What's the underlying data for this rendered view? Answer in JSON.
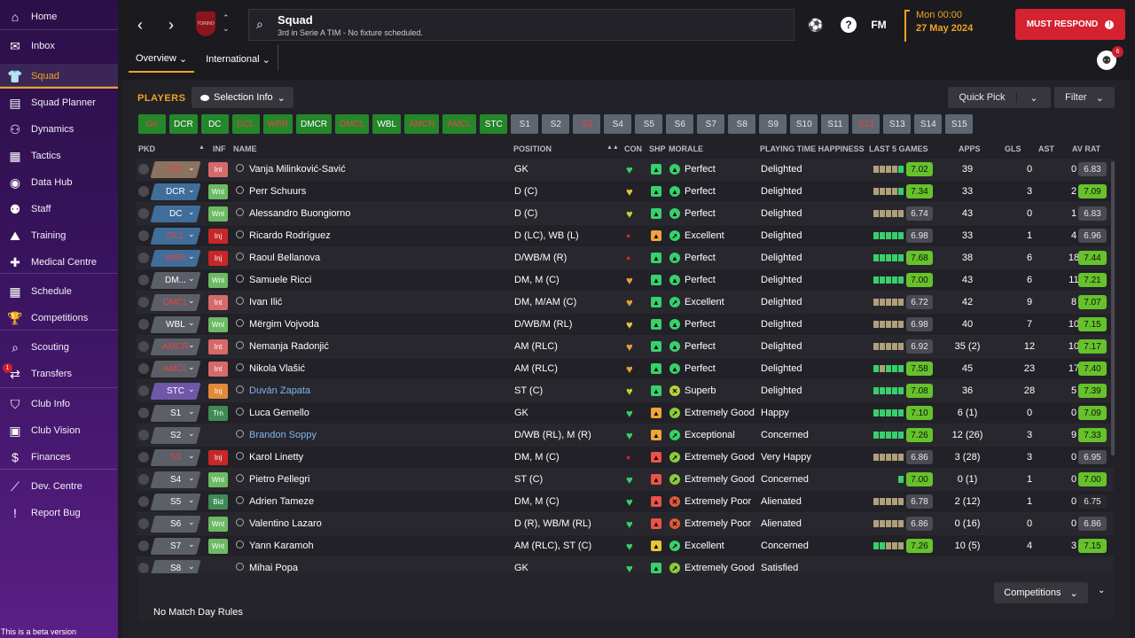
{
  "sidebar": {
    "items": [
      {
        "label": "Home",
        "icon": "home-icon",
        "glyph": "⌂"
      },
      {
        "label": "Inbox",
        "icon": "inbox-icon",
        "glyph": "✉"
      },
      {
        "label": "Squad",
        "icon": "shirt-icon",
        "glyph": "👕"
      },
      {
        "label": "Squad Planner",
        "icon": "clipboard-icon",
        "glyph": "▤"
      },
      {
        "label": "Dynamics",
        "icon": "dynamics-icon",
        "glyph": "⚇"
      },
      {
        "label": "Tactics",
        "icon": "tactics-icon",
        "glyph": "▦"
      },
      {
        "label": "Data Hub",
        "icon": "data-hub-icon",
        "glyph": "◉"
      },
      {
        "label": "Staff",
        "icon": "staff-icon",
        "glyph": "⚉"
      },
      {
        "label": "Training",
        "icon": "training-icon",
        "glyph": "⛰"
      },
      {
        "label": "Medical Centre",
        "icon": "medical-icon",
        "glyph": "✚"
      },
      {
        "label": "Schedule",
        "icon": "calendar-icon",
        "glyph": "▦"
      },
      {
        "label": "Competitions",
        "icon": "trophy-icon",
        "glyph": "🏆"
      },
      {
        "label": "Scouting",
        "icon": "search-icon",
        "glyph": "⌕"
      },
      {
        "label": "Transfers",
        "icon": "transfers-icon",
        "glyph": "⇄",
        "badge": "1"
      },
      {
        "label": "Club Info",
        "icon": "shield-icon",
        "glyph": "⛉"
      },
      {
        "label": "Club Vision",
        "icon": "briefcase-icon",
        "glyph": "▣"
      },
      {
        "label": "Finances",
        "icon": "money-icon",
        "glyph": "$"
      },
      {
        "label": "Dev. Centre",
        "icon": "dev-centre-icon",
        "glyph": "⟋"
      },
      {
        "label": "Report Bug",
        "icon": "bug-icon",
        "glyph": "!"
      }
    ],
    "beta_note": "This is a beta version"
  },
  "header": {
    "crest_text": "TORINO",
    "title": "Squad",
    "subtitle": "3rd in Serie A TIM - No fixture scheduled.",
    "fm_logo": "FM",
    "time": "Mon 00:00",
    "date": "27 May 2024",
    "must_respond": "MUST RESPOND",
    "manager_badge": "6",
    "tabs": [
      {
        "label": "Overview"
      },
      {
        "label": "International"
      }
    ]
  },
  "panel": {
    "title": "PLAYERS",
    "selection_info": "Selection Info",
    "quick_pick": "Quick Pick",
    "filter": "Filter",
    "competitions": "Competitions",
    "match_rules": "No Match Day Rules",
    "chips": [
      {
        "label": "GK",
        "state": "warn"
      },
      {
        "label": "DCR",
        "state": "ok"
      },
      {
        "label": "DC",
        "state": "ok"
      },
      {
        "label": "DCL",
        "state": "warn"
      },
      {
        "label": "WBR",
        "state": "warn"
      },
      {
        "label": "DMCR",
        "state": "ok"
      },
      {
        "label": "DMCL",
        "state": "warn"
      },
      {
        "label": "WBL",
        "state": "ok"
      },
      {
        "label": "AMCR",
        "state": "warn"
      },
      {
        "label": "AMCL",
        "state": "warn"
      },
      {
        "label": "STC",
        "state": "ok"
      },
      {
        "label": "S1",
        "state": "sub"
      },
      {
        "label": "S2",
        "state": "sub"
      },
      {
        "label": "S3",
        "state": "subred"
      },
      {
        "label": "S4",
        "state": "sub"
      },
      {
        "label": "S5",
        "state": "sub"
      },
      {
        "label": "S6",
        "state": "sub"
      },
      {
        "label": "S7",
        "state": "sub"
      },
      {
        "label": "S8",
        "state": "sub"
      },
      {
        "label": "S9",
        "state": "sub"
      },
      {
        "label": "S10",
        "state": "sub"
      },
      {
        "label": "S11",
        "state": "sub"
      },
      {
        "label": "S12",
        "state": "subred"
      },
      {
        "label": "S13",
        "state": "sub"
      },
      {
        "label": "S14",
        "state": "sub"
      },
      {
        "label": "S15",
        "state": "sub"
      }
    ],
    "columns": {
      "pkd": "PKD",
      "inf": "INF",
      "name": "NAME",
      "position": "POSITION",
      "con": "CON",
      "shp": "SHP",
      "morale": "MORALE",
      "pth": "PLAYING TIME HAPPINESS",
      "last5": "LAST 5 GAMES",
      "apps": "APPS",
      "gls": "GLS",
      "ast": "AST",
      "avrat": "AV RAT"
    },
    "rows": [
      {
        "pos": "GK",
        "pos_red": true,
        "pos_color": "#8b7360",
        "inf": "Int",
        "inf_color": "#d66a6a",
        "name": "Vanja Milinković-Savić",
        "link": false,
        "position": "GK",
        "con": "heart",
        "con_color": "#37d06c",
        "shp": "#37d06c",
        "morale_icon": "up",
        "morale_color": "#37d06c",
        "morale": "Perfect",
        "pth": "Delighted",
        "last5": [
          "#b0a07a",
          "#b0a07a",
          "#b0a07a",
          "#b0a07a",
          "#37d06c"
        ],
        "form": "7.02",
        "form_color": "#66c22b",
        "apps": "39",
        "gls": "0",
        "ast": "0",
        "avrat": "6.83",
        "avrat_color": "#4a4a52"
      },
      {
        "pos": "DCR",
        "pos_red": false,
        "pos_color": "#3f6e9a",
        "inf": "Wnt",
        "inf_color": "#6cba64",
        "name": "Perr Schuurs",
        "link": false,
        "position": "D (C)",
        "con": "heart",
        "con_color": "#e6c43a",
        "shp": "#37d06c",
        "morale_icon": "up",
        "morale_color": "#37d06c",
        "morale": "Perfect",
        "pth": "Delighted",
        "last5": [
          "#b0a07a",
          "#b0a07a",
          "#b0a07a",
          "#b0a07a",
          "#37d06c"
        ],
        "form": "7.34",
        "form_color": "#66c22b",
        "apps": "33",
        "gls": "3",
        "ast": "2",
        "avrat": "7.09",
        "avrat_color": "#66c22b"
      },
      {
        "pos": "DC",
        "pos_red": false,
        "pos_color": "#3f6e9a",
        "inf": "Wnt",
        "inf_color": "#6cba64",
        "name": "Alessandro Buongiorno",
        "link": false,
        "position": "D (C)",
        "con": "heart",
        "con_color": "#b8d43a",
        "shp": "#37d06c",
        "morale_icon": "up",
        "morale_color": "#37d06c",
        "morale": "Perfect",
        "pth": "Delighted",
        "last5": [
          "#b0a07a",
          "#b0a07a",
          "#b0a07a",
          "#b0a07a",
          "#b0a07a"
        ],
        "form": "6.74",
        "form_color": "#4a4a52",
        "apps": "43",
        "gls": "0",
        "ast": "1",
        "avrat": "6.83",
        "avrat_color": "#4a4a52"
      },
      {
        "pos": "DCL",
        "pos_red": true,
        "pos_color": "#3f6e9a",
        "inf": "Inj",
        "inf_color": "#c62828",
        "name": "Ricardo Rodríguez",
        "link": false,
        "position": "D (LC), WB (L)",
        "con": "dot",
        "con_color": "#c62828",
        "shp": "#f0a43a",
        "morale_icon": "right",
        "morale_color": "#37d06c",
        "morale": "Excellent",
        "pth": "Delighted",
        "last5": [
          "#37d06c",
          "#37d06c",
          "#37d06c",
          "#37d06c",
          "#37d06c"
        ],
        "form": "6.98",
        "form_color": "#4a4a52",
        "apps": "33",
        "gls": "1",
        "ast": "4",
        "avrat": "6.96",
        "avrat_color": "#4a4a52"
      },
      {
        "pos": "WBR",
        "pos_red": true,
        "pos_color": "#3f6e9a",
        "inf": "Inj",
        "inf_color": "#c62828",
        "name": "Raoul Bellanova",
        "link": false,
        "position": "D/WB/M (R)",
        "con": "dot",
        "con_color": "#c62828",
        "shp": "#37d06c",
        "morale_icon": "up",
        "morale_color": "#37d06c",
        "morale": "Perfect",
        "pth": "Delighted",
        "last5": [
          "#37d06c",
          "#37d06c",
          "#37d06c",
          "#37d06c",
          "#37d06c"
        ],
        "form": "7.68",
        "form_color": "#66c22b",
        "apps": "38",
        "gls": "6",
        "ast": "18",
        "avrat": "7.44",
        "avrat_color": "#66c22b"
      },
      {
        "pos": "DM...",
        "pos_red": false,
        "pos_color": "#5b5f68",
        "inf": "Wnt",
        "inf_color": "#6cba64",
        "name": "Samuele Ricci",
        "link": false,
        "position": "DM, M (C)",
        "con": "heart",
        "con_color": "#e6a33a",
        "shp": "#37d06c",
        "morale_icon": "up",
        "morale_color": "#37d06c",
        "morale": "Perfect",
        "pth": "Delighted",
        "last5": [
          "#37d06c",
          "#37d06c",
          "#37d06c",
          "#37d06c",
          "#37d06c"
        ],
        "form": "7.00",
        "form_color": "#66c22b",
        "apps": "43",
        "gls": "6",
        "ast": "11",
        "avrat": "7.21",
        "avrat_color": "#66c22b"
      },
      {
        "pos": "DMCL",
        "pos_red": true,
        "pos_color": "#5b5f68",
        "inf": "Int",
        "inf_color": "#d66a6a",
        "name": "Ivan Ilić",
        "link": false,
        "position": "DM, M/AM (C)",
        "con": "heart",
        "con_color": "#e6a33a",
        "shp": "#37d06c",
        "morale_icon": "right",
        "morale_color": "#37d06c",
        "morale": "Excellent",
        "pth": "Delighted",
        "last5": [
          "#b0a07a",
          "#b0a07a",
          "#b0a07a",
          "#b0a07a",
          "#b0a07a"
        ],
        "form": "6.72",
        "form_color": "#4a4a52",
        "apps": "42",
        "gls": "9",
        "ast": "8",
        "avrat": "7.07",
        "avrat_color": "#66c22b"
      },
      {
        "pos": "WBL",
        "pos_red": false,
        "pos_color": "#5b5f68",
        "inf": "Wnt",
        "inf_color": "#6cba64",
        "name": "Mërgim Vojvoda",
        "link": false,
        "position": "D/WB/M (RL)",
        "con": "heart",
        "con_color": "#e6c43a",
        "shp": "#37d06c",
        "morale_icon": "up",
        "morale_color": "#37d06c",
        "morale": "Perfect",
        "pth": "Delighted",
        "last5": [
          "#b0a07a",
          "#b0a07a",
          "#b0a07a",
          "#b0a07a",
          "#b0a07a"
        ],
        "form": "6.98",
        "form_color": "#4a4a52",
        "apps": "40",
        "gls": "7",
        "ast": "10",
        "avrat": "7.15",
        "avrat_color": "#66c22b"
      },
      {
        "pos": "AMCR",
        "pos_red": true,
        "pos_color": "#5b5f68",
        "inf": "Int",
        "inf_color": "#d66a6a",
        "name": "Nemanja Radonjić",
        "link": false,
        "position": "AM (RLC)",
        "con": "heart",
        "con_color": "#e6a33a",
        "shp": "#37d06c",
        "morale_icon": "up",
        "morale_color": "#37d06c",
        "morale": "Perfect",
        "pth": "Delighted",
        "last5": [
          "#b0a07a",
          "#b0a07a",
          "#b0a07a",
          "#b0a07a",
          "#b0a07a"
        ],
        "form": "6.92",
        "form_color": "#4a4a52",
        "apps": "35 (2)",
        "gls": "12",
        "ast": "10",
        "avrat": "7.17",
        "avrat_color": "#66c22b"
      },
      {
        "pos": "AMCL",
        "pos_red": true,
        "pos_color": "#5b5f68",
        "inf": "Int",
        "inf_color": "#d66a6a",
        "name": "Nikola Vlašić",
        "link": false,
        "position": "AM (RLC)",
        "con": "heart",
        "con_color": "#e6a33a",
        "shp": "#37d06c",
        "morale_icon": "up",
        "morale_color": "#37d06c",
        "morale": "Perfect",
        "pth": "Delighted",
        "last5": [
          "#37d06c",
          "#b0a07a",
          "#37d06c",
          "#37d06c",
          "#37d06c"
        ],
        "form": "7.58",
        "form_color": "#66c22b",
        "apps": "45",
        "gls": "23",
        "ast": "17",
        "avrat": "7.40",
        "avrat_color": "#66c22b"
      },
      {
        "pos": "STC",
        "pos_red": false,
        "pos_color": "#7057a8",
        "inf": "Inj",
        "inf_color": "#e08a3a",
        "name": "Duván Zapata",
        "link": true,
        "position": "ST (C)",
        "con": "heart",
        "con_color": "#b8d43a",
        "shp": "#37d06c",
        "morale_icon": "down",
        "morale_color": "#b8d43a",
        "morale": "Superb",
        "pth": "Delighted",
        "last5": [
          "#37d06c",
          "#37d06c",
          "#37d06c",
          "#37d06c",
          "#37d06c"
        ],
        "form": "7.08",
        "form_color": "#66c22b",
        "apps": "36",
        "gls": "28",
        "ast": "5",
        "avrat": "7.39",
        "avrat_color": "#66c22b"
      },
      {
        "pos": "S1",
        "pos_red": false,
        "pos_color": "#5b5f68",
        "inf": "Trn",
        "inf_color": "#3f8b55",
        "name": "Luca Gemello",
        "link": false,
        "position": "GK",
        "con": "heart",
        "con_color": "#37d06c",
        "shp": "#f0a43a",
        "morale_icon": "right",
        "morale_color": "#8ccb3a",
        "morale": "Extremely Good",
        "pth": "Happy",
        "last5": [
          "#37d06c",
          "#37d06c",
          "#37d06c",
          "#37d06c",
          "#37d06c"
        ],
        "form": "7.10",
        "form_color": "#66c22b",
        "apps": "6 (1)",
        "gls": "0",
        "ast": "0",
        "avrat": "7.09",
        "avrat_color": "#66c22b"
      },
      {
        "pos": "S2",
        "pos_red": false,
        "pos_color": "#5b5f68",
        "inf": "",
        "inf_color": "transparent",
        "name": "Brandon Soppy",
        "link": true,
        "position": "D/WB (RL), M (R)",
        "con": "heart",
        "con_color": "#37d06c",
        "shp": "#f0a43a",
        "morale_icon": "right",
        "morale_color": "#37d06c",
        "morale": "Exceptional",
        "pth": "Concerned",
        "last5": [
          "#37d06c",
          "#37d06c",
          "#37d06c",
          "#37d06c",
          "#37d06c"
        ],
        "form": "7.26",
        "form_color": "#66c22b",
        "apps": "12 (26)",
        "gls": "3",
        "ast": "9",
        "avrat": "7.33",
        "avrat_color": "#66c22b"
      },
      {
        "pos": "S3",
        "pos_red": true,
        "pos_color": "#5b5f68",
        "inf": "Inj",
        "inf_color": "#c62828",
        "name": "Karol Linetty",
        "link": false,
        "position": "DM, M (C)",
        "con": "dot",
        "con_color": "#c62828",
        "shp": "#e8534a",
        "morale_icon": "right",
        "morale_color": "#8ccb3a",
        "morale": "Extremely Good",
        "pth": "Very Happy",
        "last5": [
          "#b0a07a",
          "#b0a07a",
          "#b0a07a",
          "#b0a07a",
          "#b0a07a"
        ],
        "form": "6.86",
        "form_color": "#4a4a52",
        "apps": "3 (28)",
        "gls": "3",
        "ast": "0",
        "avrat": "6.95",
        "avrat_color": "#4a4a52"
      },
      {
        "pos": "S4",
        "pos_red": false,
        "pos_color": "#5b5f68",
        "inf": "Wnt",
        "inf_color": "#6cba64",
        "name": "Pietro Pellegri",
        "link": false,
        "position": "ST (C)",
        "con": "heart",
        "con_color": "#37d06c",
        "shp": "#e8534a",
        "morale_icon": "right",
        "morale_color": "#8ccb3a",
        "morale": "Extremely Good",
        "pth": "Concerned",
        "last5": [
          "#37d06c"
        ],
        "form": "7.00",
        "form_color": "#66c22b",
        "apps": "0 (1)",
        "gls": "1",
        "ast": "0",
        "avrat": "7.00",
        "avrat_color": "#66c22b"
      },
      {
        "pos": "S5",
        "pos_red": false,
        "pos_color": "#5b5f68",
        "inf": "Bid",
        "inf_color": "#3f8b55",
        "name": "Adrien Tameze",
        "link": false,
        "position": "DM, M (C)",
        "con": "heart",
        "con_color": "#37d06c",
        "shp": "#e8534a",
        "morale_icon": "down",
        "morale_color": "#e05a3a",
        "morale": "Extremely Poor",
        "pth": "Alienated",
        "last5": [
          "#b0a07a",
          "#b0a07a",
          "#b0a07a",
          "#b0a07a",
          "#b0a07a"
        ],
        "form": "6.78",
        "form_color": "#4a4a52",
        "apps": "2 (12)",
        "gls": "1",
        "ast": "0",
        "avrat": "6.75",
        "avrat_color": "#2a292f"
      },
      {
        "pos": "S6",
        "pos_red": false,
        "pos_color": "#5b5f68",
        "inf": "Wnt",
        "inf_color": "#6cba64",
        "name": "Valentino Lazaro",
        "link": false,
        "position": "D (R), WB/M (RL)",
        "con": "heart",
        "con_color": "#37d06c",
        "shp": "#e8534a",
        "morale_icon": "down",
        "morale_color": "#e05a3a",
        "morale": "Extremely Poor",
        "pth": "Alienated",
        "last5": [
          "#b0a07a",
          "#b0a07a",
          "#b0a07a",
          "#b0a07a",
          "#b0a07a"
        ],
        "form": "6.86",
        "form_color": "#4a4a52",
        "apps": "0 (16)",
        "gls": "0",
        "ast": "0",
        "avrat": "6.86",
        "avrat_color": "#4a4a52"
      },
      {
        "pos": "S7",
        "pos_red": false,
        "pos_color": "#5b5f68",
        "inf": "Wnt",
        "inf_color": "#6cba64",
        "name": "Yann Karamoh",
        "link": false,
        "position": "AM (RLC), ST (C)",
        "con": "heart",
        "con_color": "#37d06c",
        "shp": "#e6c43a",
        "morale_icon": "right",
        "morale_color": "#37d06c",
        "morale": "Excellent",
        "pth": "Concerned",
        "last5": [
          "#37d06c",
          "#37d06c",
          "#b0a07a",
          "#b0a07a",
          "#b0a07a"
        ],
        "form": "7.26",
        "form_color": "#66c22b",
        "apps": "10 (5)",
        "gls": "4",
        "ast": "3",
        "avrat": "7.15",
        "avrat_color": "#66c22b"
      },
      {
        "pos": "S8",
        "pos_red": false,
        "pos_color": "#5b5f68",
        "inf": "",
        "inf_color": "transparent",
        "name": "Mihai Popa",
        "link": false,
        "position": "GK",
        "con": "heart",
        "con_color": "#37d06c",
        "shp": "#37d06c",
        "morale_icon": "right",
        "morale_color": "#8ccb3a",
        "morale": "Extremely Good",
        "pth": "Satisfied",
        "last5": [],
        "form": "",
        "form_color": "transparent",
        "apps": "",
        "gls": "",
        "ast": "",
        "avrat": "",
        "avrat_color": "transparent"
      }
    ]
  }
}
